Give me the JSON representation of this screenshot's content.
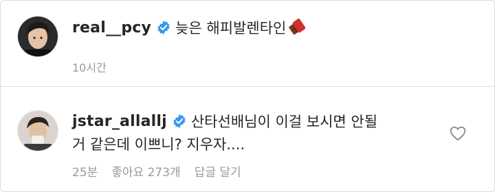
{
  "post": {
    "username": "real__pcy",
    "caption": "늦은 해피발렌타인",
    "emoji": "chocolate-bar-icon",
    "time": "10시간"
  },
  "comment": {
    "username": "jstar_allallj",
    "text_line1": "산타선배님이 이걸 보시면 안될",
    "text_line2": "거 같은데 이쁘니? 지우자....",
    "time": "25분",
    "likes": "좋아요 273개",
    "reply": "답글 달기"
  },
  "colors": {
    "verified": "#3897f0",
    "text": "#262626",
    "muted": "#999999",
    "border": "#dbdbdb"
  }
}
